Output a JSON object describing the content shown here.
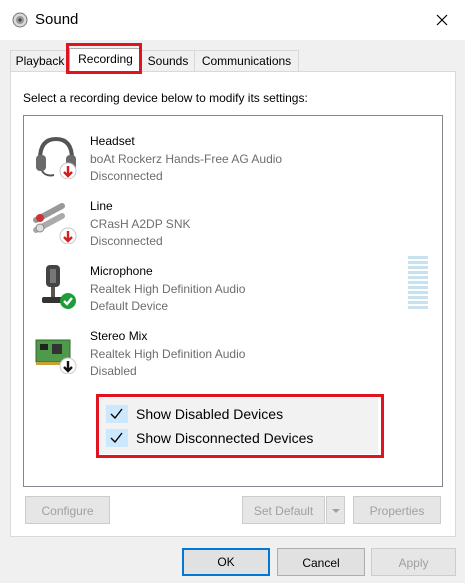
{
  "window": {
    "title": "Sound"
  },
  "tabs": [
    {
      "label": "Playback"
    },
    {
      "label": "Recording"
    },
    {
      "label": "Sounds"
    },
    {
      "label": "Communications"
    }
  ],
  "instruction": "Select a recording device below to modify its settings:",
  "devices": [
    {
      "name": "Headset",
      "description": "boAt Rockerz Hands-Free AG Audio",
      "status": "Disconnected",
      "icon": "headset-icon",
      "badge": "red-down-arrow"
    },
    {
      "name": "Line",
      "description": "CRasH A2DP SNK",
      "status": "Disconnected",
      "icon": "line-in-icon",
      "badge": "red-down-arrow"
    },
    {
      "name": "Microphone",
      "description": "Realtek High Definition Audio",
      "status": "Default Device",
      "icon": "microphone-icon",
      "badge": "green-check"
    },
    {
      "name": "Stereo Mix",
      "description": "Realtek High Definition Audio",
      "status": "Disabled",
      "icon": "sound-card-icon",
      "badge": "black-down-arrow"
    }
  ],
  "context_menu": [
    {
      "label": "Show Disabled Devices",
      "checked": true
    },
    {
      "label": "Show Disconnected Devices",
      "checked": true
    }
  ],
  "buttons": {
    "configure": "Configure",
    "set_default": "Set Default",
    "properties": "Properties",
    "ok": "OK",
    "cancel": "Cancel",
    "apply": "Apply"
  },
  "colors": {
    "highlight": "#e0141e",
    "accent": "#0078d7",
    "check_bg": "#cce8ff"
  }
}
